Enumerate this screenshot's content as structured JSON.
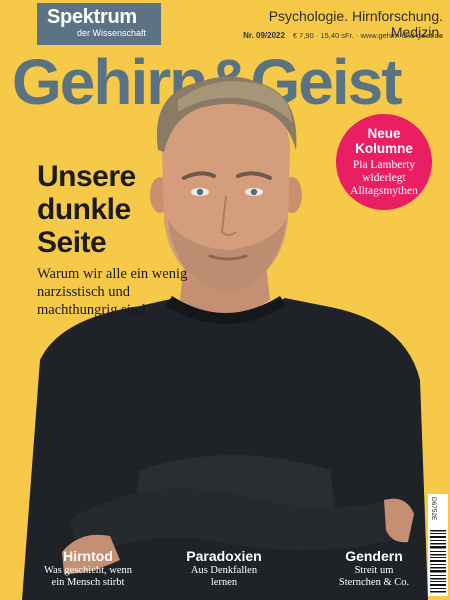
{
  "logo": {
    "name": "Spektrum",
    "subtitle": "der Wissenschaft"
  },
  "header": {
    "tagline": "Psychologie. Hirnforschung. Medizin.",
    "issue": "Nr. 09/2022",
    "price_and_url": "€ 7,90 · 15,40 sFr. · www.gehirn-und-geist.de"
  },
  "masthead": "Gehirn&Geist",
  "cover_story": {
    "headline": [
      "Unsere",
      "dunkle",
      "Seite"
    ],
    "subheadline": "Warum wir alle ein wenig narzisstisch und machthungrig sind"
  },
  "badge": {
    "title": [
      "Neue",
      "Kolumne"
    ],
    "text": [
      "Pia Lamberty",
      "widerlegt",
      "Alltagsmythen"
    ]
  },
  "teasers": [
    {
      "title": "Hirntod",
      "text": [
        "Was geschieht, wenn",
        "ein Mensch stirbt"
      ]
    },
    {
      "title": "Paradoxien",
      "text": [
        "Aus Denkfallen",
        "lernen"
      ]
    },
    {
      "title": "Gendern",
      "text": [
        "Streit um",
        "Sternchen & Co."
      ]
    }
  ],
  "barcode_code": "D6752E",
  "colors": {
    "background": "#f7c948",
    "masthead": "#5a7383",
    "logo_box": "#5b7384",
    "badge": "#e91e63",
    "sweater": "#1f2226"
  }
}
